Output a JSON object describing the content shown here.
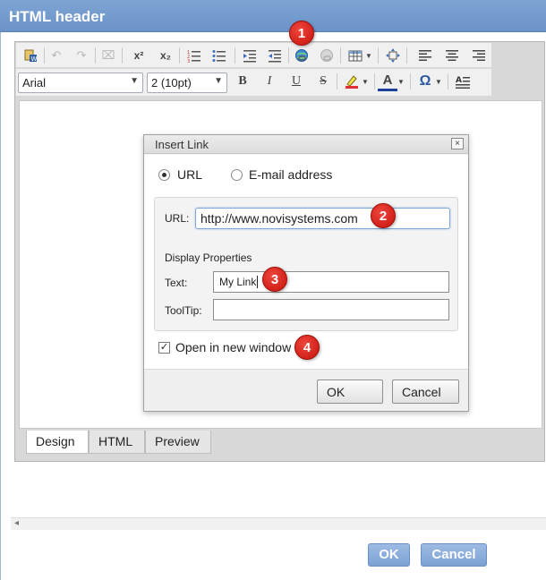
{
  "window": {
    "title": "HTML header"
  },
  "toolbar": {
    "font_family": "Arial",
    "font_size": "2 (10pt)",
    "bold": "B",
    "italic": "I",
    "underline": "U",
    "strike": "S",
    "superscript": "x²",
    "subscript": "x₂",
    "omega": "Ω",
    "text_color": "A"
  },
  "editor_tabs": [
    {
      "label": "Design",
      "active": true
    },
    {
      "label": "HTML",
      "active": false
    },
    {
      "label": "Preview",
      "active": false
    }
  ],
  "insert_link": {
    "title": "Insert Link",
    "close": "×",
    "type_options": [
      {
        "label": "URL",
        "selected": true
      },
      {
        "label": "E-mail address",
        "selected": false
      }
    ],
    "url_label": "URL:",
    "url_value": "http://www.novisystems.com",
    "display_heading": "Display Properties",
    "text_label": "Text:",
    "text_value": "My Link",
    "tooltip_label": "ToolTip:",
    "tooltip_value": "",
    "new_window_label": "Open in new window",
    "new_window_checked": true,
    "new_window_mark": "✓",
    "ok_label": "OK",
    "cancel_label": "Cancel"
  },
  "markers": [
    "1",
    "2",
    "3",
    "4"
  ],
  "scroll_arrow": "◂",
  "footer": {
    "ok_label": "OK",
    "cancel_label": "Cancel"
  },
  "colors": {
    "title_bar": "#6b93c8",
    "accent_button": "#7ba1d4",
    "marker": "#d9261e"
  }
}
